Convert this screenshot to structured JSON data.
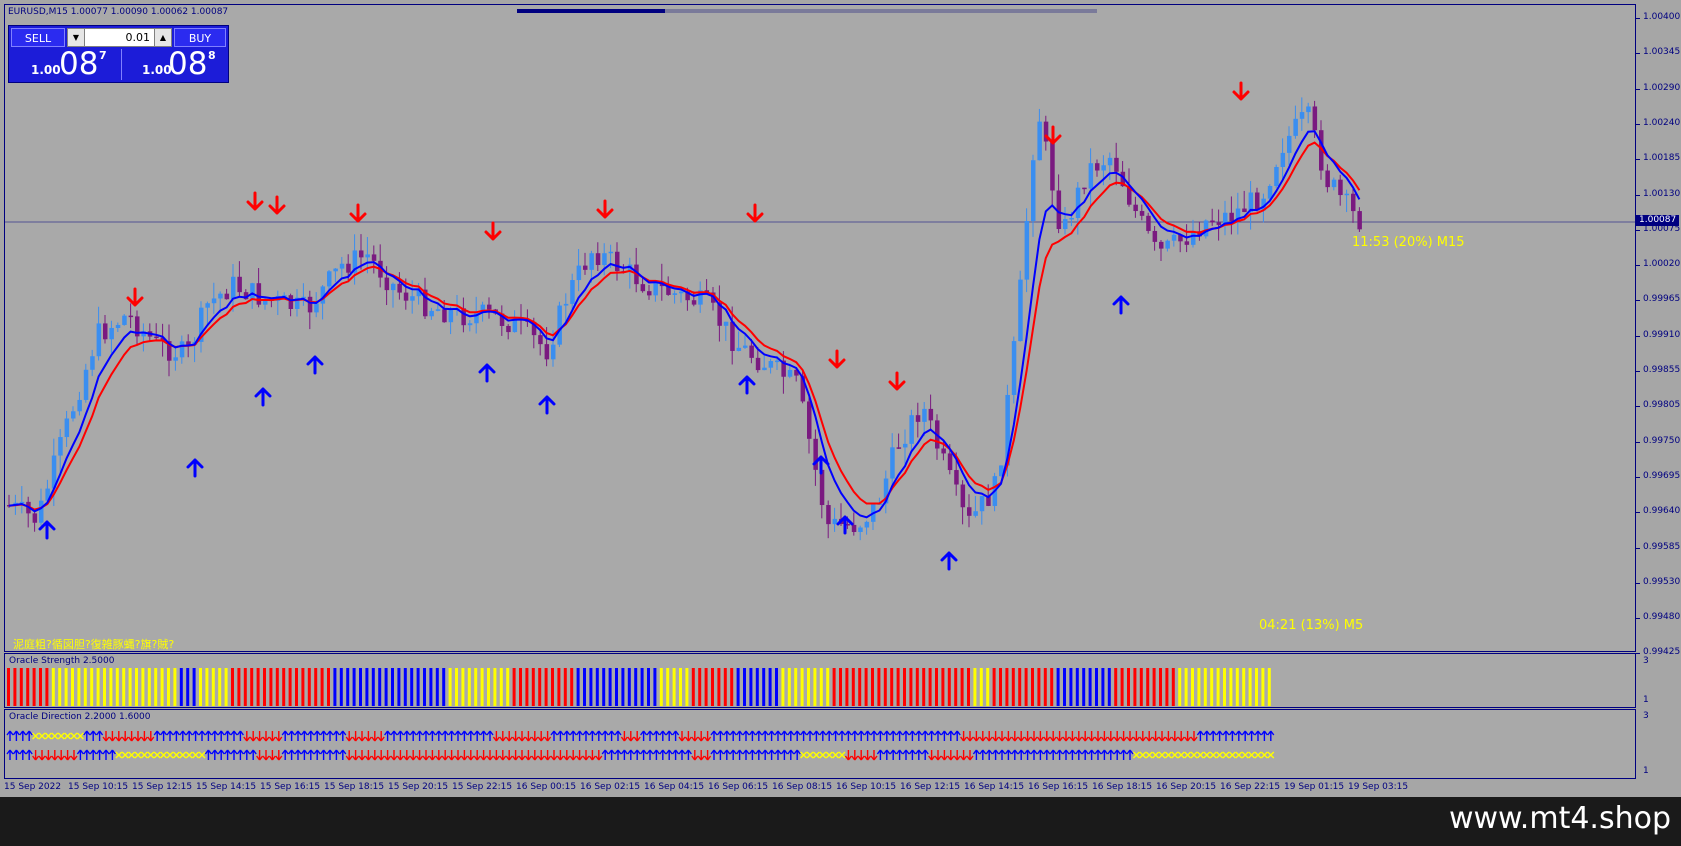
{
  "window": {
    "symbol_info": "EURUSD,M15  1.00077 1.00090 1.00062 1.00087"
  },
  "trade_panel": {
    "sell_label": "SELL",
    "buy_label": "BUY",
    "lot_value": "0.01",
    "sell_price": {
      "prefix": "1.00",
      "big": "08",
      "sup": "7"
    },
    "buy_price": {
      "prefix": "1.00",
      "big": "08",
      "sup": "8"
    }
  },
  "price_axis": {
    "labels": [
      "1.00400",
      "1.00345",
      "1.00290",
      "1.00240",
      "1.00185",
      "1.00130",
      "1.00075",
      "1.00020",
      "0.99965",
      "0.99910",
      "0.99855",
      "0.99805",
      "0.99750",
      "0.99695",
      "0.99640",
      "0.99585",
      "0.99530",
      "0.99480",
      "0.99425"
    ],
    "current_price": "1.00087"
  },
  "overlays": {
    "timer_m15": "11:53 (20%) M15",
    "timer_m5": "04:21 (13%) M5",
    "garbled_text": "泥庭粗?循図胆?復雑豚蝿?旗?賊?"
  },
  "oracle_strength": {
    "label": "Oracle Strength 2.5000",
    "axis_top": "3",
    "axis_bottom": "1"
  },
  "oracle_direction": {
    "label": "Oracle Direction 2.2000 1.6000",
    "axis_top": "3",
    "axis_bottom": "1"
  },
  "time_axis": {
    "labels": [
      "15 Sep 2022",
      "15 Sep 10:15",
      "15 Sep 12:15",
      "15 Sep 14:15",
      "15 Sep 16:15",
      "15 Sep 18:15",
      "15 Sep 20:15",
      "15 Sep 22:15",
      "16 Sep 00:15",
      "16 Sep 02:15",
      "16 Sep 04:15",
      "16 Sep 06:15",
      "16 Sep 08:15",
      "16 Sep 10:15",
      "16 Sep 12:15",
      "16 Sep 14:15",
      "16 Sep 16:15",
      "16 Sep 18:15",
      "16 Sep 20:15",
      "16 Sep 22:15",
      "19 Sep 01:15",
      "19 Sep 03:15"
    ]
  },
  "colors": {
    "bull": "#3a8ef0",
    "bear": "#7a1a80",
    "ma_fast": "#0000ff",
    "ma_slow": "#ff0000",
    "arrow_up": "#0000ff",
    "arrow_down": "#ff0000",
    "strength_blue": "#0000ff",
    "strength_yellow": "#ffff00",
    "strength_red": "#ff0000"
  },
  "watermark": "www.mt4.shop"
}
